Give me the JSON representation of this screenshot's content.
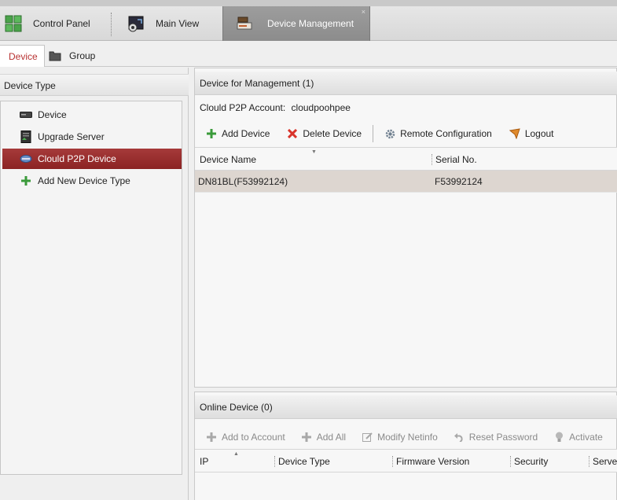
{
  "top_tabs": {
    "control_panel": "Control Panel",
    "main_view": "Main View",
    "device_management": "Device Management",
    "close_glyph": "×"
  },
  "sub_tabs": {
    "device": "Device",
    "group": "Group"
  },
  "left_panel": {
    "header": "Device Type",
    "items": [
      {
        "label": "Device",
        "icon": "device-icon"
      },
      {
        "label": "Upgrade Server",
        "icon": "server-icon"
      },
      {
        "label": "Clould P2P Device",
        "icon": "cloud-device-icon",
        "selected": true
      },
      {
        "label": "Add New Device Type",
        "icon": "plus-icon"
      }
    ]
  },
  "management": {
    "header": "Device for Management (1)",
    "account_label": "Clould P2P Account:",
    "account_value": "cloudpoohpee",
    "toolbar": {
      "add_device": "Add Device",
      "delete_device": "Delete Device",
      "remote_configuration": "Remote Configuration",
      "logout": "Logout"
    },
    "columns": [
      "Device Name",
      "Serial No."
    ],
    "rows": [
      {
        "device_name": "DN81BL(F53992124)",
        "serial_no": "F53992124"
      }
    ]
  },
  "online": {
    "header": "Online Device (0)",
    "toolbar": {
      "add_to_account": "Add to Account",
      "add_all": "Add All",
      "modify_netinfo": "Modify Netinfo",
      "reset_password": "Reset Password",
      "activate": "Activate"
    },
    "columns": [
      "IP",
      "Device Type",
      "Firmware Version",
      "Security",
      "Server"
    ]
  },
  "colors": {
    "accent_red": "#b83232",
    "selected_row": "#8b2323",
    "add_green": "#3a9a3a"
  }
}
